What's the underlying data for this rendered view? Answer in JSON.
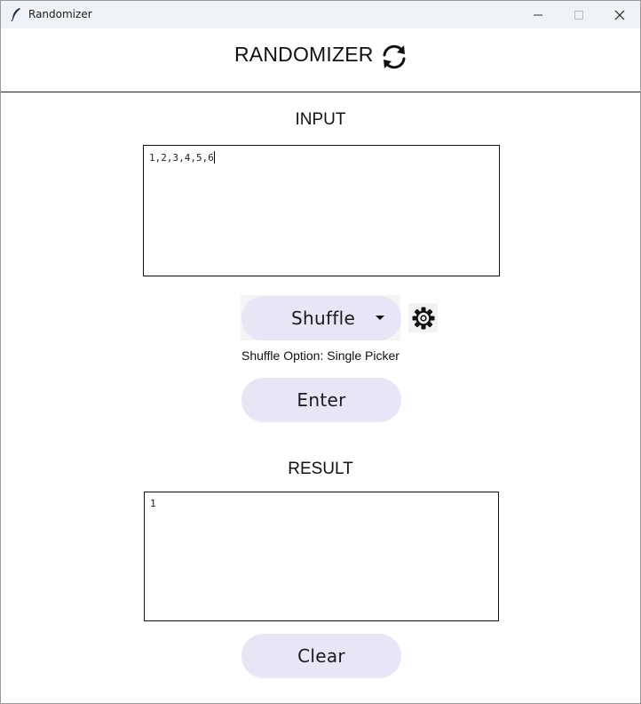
{
  "window": {
    "title": "Randomizer",
    "controls": {
      "minimize": "minimize-icon",
      "maximize": "maximize-icon",
      "close": "close-icon"
    }
  },
  "header": {
    "title": "RANDOMIZER",
    "icon": "refresh-icon"
  },
  "input": {
    "label": "INPUT",
    "value": "1,2,3,4,5,6"
  },
  "shuffle": {
    "selected": "Shuffle",
    "settings_icon": "gear-icon",
    "option_text": "Shuffle Option: Single Picker"
  },
  "buttons": {
    "enter_label": "Enter",
    "clear_label": "Clear"
  },
  "result": {
    "label": "RESULT",
    "value": "1"
  },
  "colors": {
    "button_bg": "#e6e6f7",
    "titlebar_bg": "#eff3f8",
    "border": "#111111"
  }
}
